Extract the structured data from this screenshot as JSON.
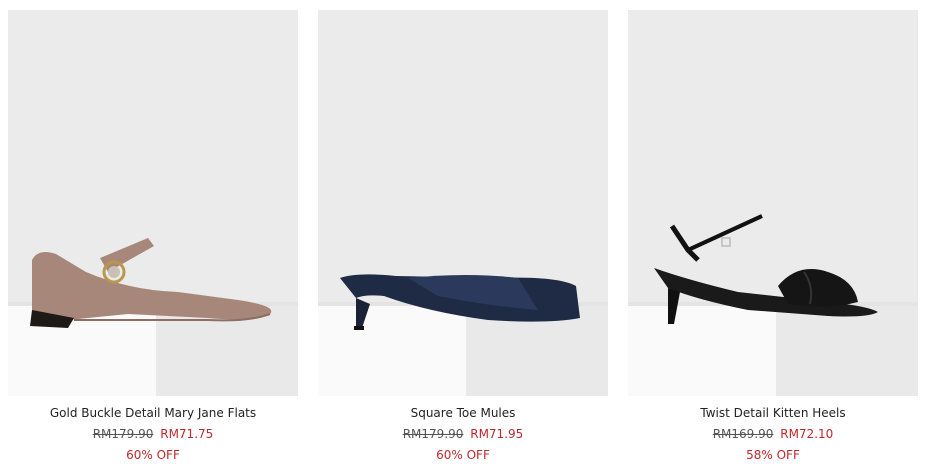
{
  "products": [
    {
      "name": "Gold Buckle Detail Mary Jane Flats",
      "old_price": "RM179.90",
      "new_price": "RM71.75",
      "discount": "60% OFF",
      "image_label": "mary-jane-flat-taupe"
    },
    {
      "name": "Square Toe Mules",
      "old_price": "RM179.90",
      "new_price": "RM71.95",
      "discount": "60% OFF",
      "image_label": "square-toe-mule-navy"
    },
    {
      "name": "Twist Detail Kitten Heels",
      "old_price": "RM169.90",
      "new_price": "RM72.10",
      "discount": "58% OFF",
      "image_label": "kitten-heel-black"
    }
  ],
  "colors": {
    "sale_red": "#c0282d",
    "photo_bg": "#ececec",
    "pedestal": "#f7f7f7"
  }
}
